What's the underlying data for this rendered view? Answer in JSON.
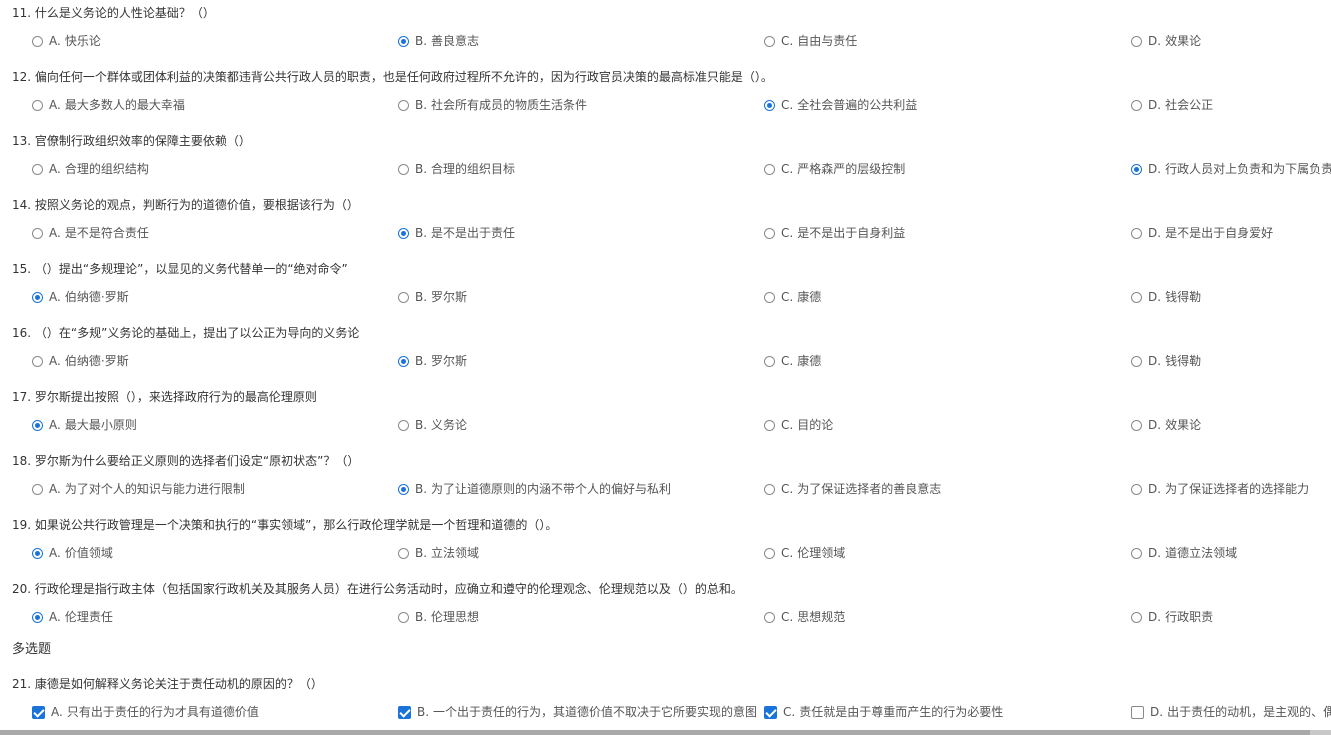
{
  "accent_color": "#1a73d9",
  "questions": [
    {
      "title": "11. 什么是义务论的人性论基础？（）",
      "type": "single",
      "options": [
        {
          "letter": "A.",
          "text": "快乐论",
          "checked": false
        },
        {
          "letter": "B.",
          "text": "善良意志",
          "checked": true
        },
        {
          "letter": "C.",
          "text": "自由与责任",
          "checked": false
        },
        {
          "letter": "D.",
          "text": "效果论",
          "checked": false
        }
      ]
    },
    {
      "title": "12. 偏向任何一个群体或团体利益的决策都违背公共行政人员的职责，也是任何政府过程所不允许的，因为行政官员决策的最高标准只能是（）。",
      "type": "single",
      "options": [
        {
          "letter": "A.",
          "text": "最大多数人的最大幸福",
          "checked": false
        },
        {
          "letter": "B.",
          "text": "社会所有成员的物质生活条件",
          "checked": false
        },
        {
          "letter": "C.",
          "text": "全社会普遍的公共利益",
          "checked": true
        },
        {
          "letter": "D.",
          "text": "社会公正",
          "checked": false
        }
      ]
    },
    {
      "title": "13. 官僚制行政组织效率的保障主要依赖（）",
      "type": "single",
      "options": [
        {
          "letter": "A.",
          "text": "合理的组织结构",
          "checked": false
        },
        {
          "letter": "B.",
          "text": "合理的组织目标",
          "checked": false
        },
        {
          "letter": "C.",
          "text": "严格森严的层级控制",
          "checked": false
        },
        {
          "letter": "D.",
          "text": "行政人员对上负责和为下属负责",
          "checked": true
        }
      ]
    },
    {
      "title": "14. 按照义务论的观点，判断行为的道德价值，要根据该行为（）",
      "type": "single",
      "options": [
        {
          "letter": "A.",
          "text": "是不是符合责任",
          "checked": false
        },
        {
          "letter": "B.",
          "text": "是不是出于责任",
          "checked": true
        },
        {
          "letter": "C.",
          "text": "是不是出于自身利益",
          "checked": false
        },
        {
          "letter": "D.",
          "text": "是不是出于自身爱好",
          "checked": false
        }
      ]
    },
    {
      "title": "15. （）提出“多规理论”，以显见的义务代替单一的“绝对命令”",
      "type": "single",
      "options": [
        {
          "letter": "A.",
          "text": "伯纳德·罗斯",
          "checked": true
        },
        {
          "letter": "B.",
          "text": "罗尔斯",
          "checked": false
        },
        {
          "letter": "C.",
          "text": "康德",
          "checked": false
        },
        {
          "letter": "D.",
          "text": "钱得勒",
          "checked": false
        }
      ]
    },
    {
      "title": "16. （）在“多规”义务论的基础上，提出了以公正为导向的义务论",
      "type": "single",
      "options": [
        {
          "letter": "A.",
          "text": "伯纳德·罗斯",
          "checked": false
        },
        {
          "letter": "B.",
          "text": "罗尔斯",
          "checked": true
        },
        {
          "letter": "C.",
          "text": "康德",
          "checked": false
        },
        {
          "letter": "D.",
          "text": "钱得勒",
          "checked": false
        }
      ]
    },
    {
      "title": "17. 罗尔斯提出按照（），来选择政府行为的最高伦理原则",
      "type": "single",
      "options": [
        {
          "letter": "A.",
          "text": "最大最小原则",
          "checked": true
        },
        {
          "letter": "B.",
          "text": "义务论",
          "checked": false
        },
        {
          "letter": "C.",
          "text": "目的论",
          "checked": false
        },
        {
          "letter": "D.",
          "text": "效果论",
          "checked": false
        }
      ]
    },
    {
      "title": "18. 罗尔斯为什么要给正义原则的选择者们设定“原初状态”？（）",
      "type": "single",
      "options": [
        {
          "letter": "A.",
          "text": "为了对个人的知识与能力进行限制",
          "checked": false
        },
        {
          "letter": "B.",
          "text": "为了让道德原则的内涵不带个人的偏好与私利",
          "checked": true
        },
        {
          "letter": "C.",
          "text": "为了保证选择者的善良意志",
          "checked": false
        },
        {
          "letter": "D.",
          "text": "为了保证选择者的选择能力",
          "checked": false
        }
      ]
    },
    {
      "title": "19. 如果说公共行政管理是一个决策和执行的“事实领域”，那么行政伦理学就是一个哲理和道德的（）。",
      "type": "single",
      "options": [
        {
          "letter": "A.",
          "text": "价值领域",
          "checked": true
        },
        {
          "letter": "B.",
          "text": "立法领域",
          "checked": false
        },
        {
          "letter": "C.",
          "text": "伦理领域",
          "checked": false
        },
        {
          "letter": "D.",
          "text": "道德立法领域",
          "checked": false
        }
      ]
    },
    {
      "title": "20. 行政伦理是指行政主体（包括国家行政机关及其服务人员）在进行公务活动时，应确立和遵守的伦理观念、伦理规范以及（）的总和。",
      "type": "single",
      "options": [
        {
          "letter": "A.",
          "text": "伦理责任",
          "checked": true
        },
        {
          "letter": "B.",
          "text": "伦理思想",
          "checked": false
        },
        {
          "letter": "C.",
          "text": "思想规范",
          "checked": false
        },
        {
          "letter": "D.",
          "text": "行政职责",
          "checked": false
        }
      ]
    }
  ],
  "multi_section_title": "多选题",
  "multi_questions": [
    {
      "title": "21. 康德是如何解释义务论关注于责任动机的原因的？（）",
      "type": "multi",
      "options": [
        {
          "letter": "A.",
          "text": "只有出于责任的行为才具有道德价值",
          "checked": true
        },
        {
          "letter": "B.",
          "text": "一个出于责任的行为，其道德价值不取决于它所要实现的意图",
          "checked": true
        },
        {
          "letter": "C.",
          "text": "责任就是由于尊重而产生的行为必要性",
          "checked": true
        },
        {
          "letter": "D.",
          "text": "出于责任的动机，是主观的、偶然的",
          "checked": false
        }
      ]
    }
  ]
}
